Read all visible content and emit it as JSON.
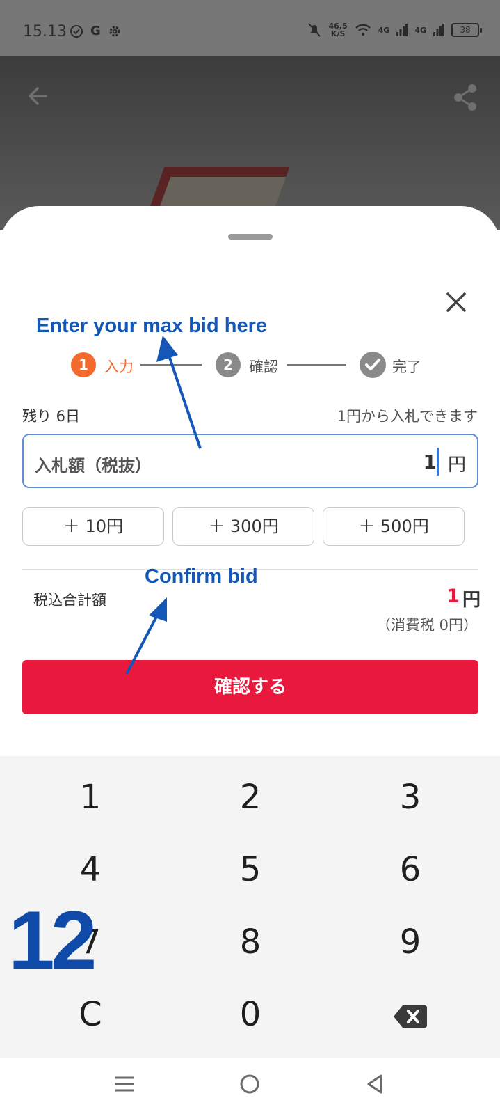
{
  "status_bar": {
    "time": "15.13",
    "net_speed_top": "46,5",
    "net_speed_unit": "K/S",
    "signal_1": "4G",
    "signal_2": "4G",
    "battery": "38"
  },
  "sheet": {
    "steps": [
      {
        "number": "1",
        "label": "入力"
      },
      {
        "number": "2",
        "label": "確認"
      },
      {
        "label": "完了"
      }
    ],
    "remaining": "残り 6日",
    "min_bid_note": "1円から入札できます",
    "bid_field": {
      "label": "入札額（税抜）",
      "value": "1",
      "unit": "円"
    },
    "increments": [
      "＋ 10円",
      "＋ 300円",
      "＋ 500円"
    ],
    "total": {
      "label": "税込合計額",
      "value": "1",
      "unit": "円",
      "tax_note": "（消費税 0円）"
    },
    "confirm_label": "確認する"
  },
  "annotations": {
    "enter_bid": "Enter your max bid here",
    "confirm_bid": "Confirm bid",
    "step_number": "12"
  },
  "keypad": {
    "keys": [
      "1",
      "2",
      "3",
      "4",
      "5",
      "6",
      "7",
      "8",
      "9",
      "C",
      "0"
    ]
  },
  "colors": {
    "accent_red": "#e8193c",
    "step_active": "#f26a2c",
    "step_inactive": "#8a8a8a",
    "annotation_blue": "#1457b7"
  }
}
